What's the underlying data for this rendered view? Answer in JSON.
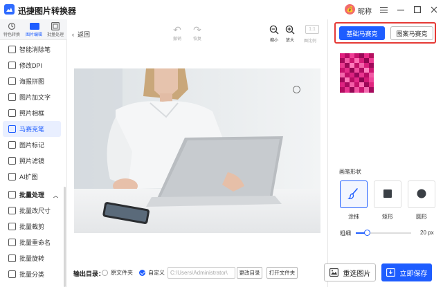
{
  "app": {
    "title": "迅捷图片转换器",
    "user_name": "昵称",
    "user_avatar": "💰"
  },
  "window_controls": [
    "menu-icon",
    "minimize-icon",
    "maximize-icon",
    "close-icon"
  ],
  "tool_tabs": [
    {
      "label": "特色转换",
      "active": false
    },
    {
      "label": "图片编辑",
      "active": true
    },
    {
      "label": "批量处理",
      "active": false
    }
  ],
  "sidebar": {
    "items": [
      {
        "label": "智能消除笔",
        "active": false,
        "type": "item"
      },
      {
        "label": "修改DPI",
        "active": false,
        "type": "item"
      },
      {
        "label": "海报拼图",
        "active": false,
        "type": "item"
      },
      {
        "label": "图片加文字",
        "active": false,
        "type": "item"
      },
      {
        "label": "照片相框",
        "active": false,
        "type": "item"
      },
      {
        "label": "马赛克笔",
        "active": true,
        "type": "item"
      },
      {
        "label": "图片标记",
        "active": false,
        "type": "item"
      },
      {
        "label": "照片滤镜",
        "active": false,
        "type": "item"
      },
      {
        "label": "AI扩图",
        "active": false,
        "type": "item"
      },
      {
        "label": "批量处理",
        "active": false,
        "type": "group"
      },
      {
        "label": "批量改尺寸",
        "active": false,
        "type": "item"
      },
      {
        "label": "批量裁剪",
        "active": false,
        "type": "item"
      },
      {
        "label": "批量重命名",
        "active": false,
        "type": "item"
      },
      {
        "label": "批量旋转",
        "active": false,
        "type": "item"
      },
      {
        "label": "批量分类",
        "active": false,
        "type": "item"
      }
    ]
  },
  "toolbar": {
    "back_label": "返回",
    "undo_label": "撤销",
    "redo_label": "恢复",
    "zoom_out_label": "缩小",
    "zoom_in_label": "放大",
    "ratio_value": "1:1",
    "ratio_label": "图比例"
  },
  "mosaic_mode": {
    "basic_label": "基础马赛克",
    "pattern_label": "图案马赛克",
    "selected": "basic"
  },
  "brush": {
    "section_title": "画笔形状",
    "shapes": [
      {
        "label": "涂抹",
        "icon": "brush-icon",
        "active": true
      },
      {
        "label": "矩形",
        "icon": "square-icon",
        "active": false
      },
      {
        "label": "圆形",
        "icon": "circle-icon",
        "active": false
      }
    ],
    "thickness_label": "粗细",
    "thickness_value": 20,
    "thickness_max": 100,
    "thickness_display": "20  px"
  },
  "output": {
    "label": "输出目录：",
    "option_original": "原文件夹",
    "option_custom": "自定义",
    "selected": "custom",
    "path_placeholder": "C:\\Users\\Administrator\\",
    "change_dir_label": "更改目录",
    "open_folder_label": "打开文件夹"
  },
  "actions": {
    "reselect_label": "重选图片",
    "save_label": "立即保存"
  },
  "colors": {
    "accent": "#1e5dff",
    "highlight_border": "#e53935",
    "mosaic": "#d40f77"
  }
}
